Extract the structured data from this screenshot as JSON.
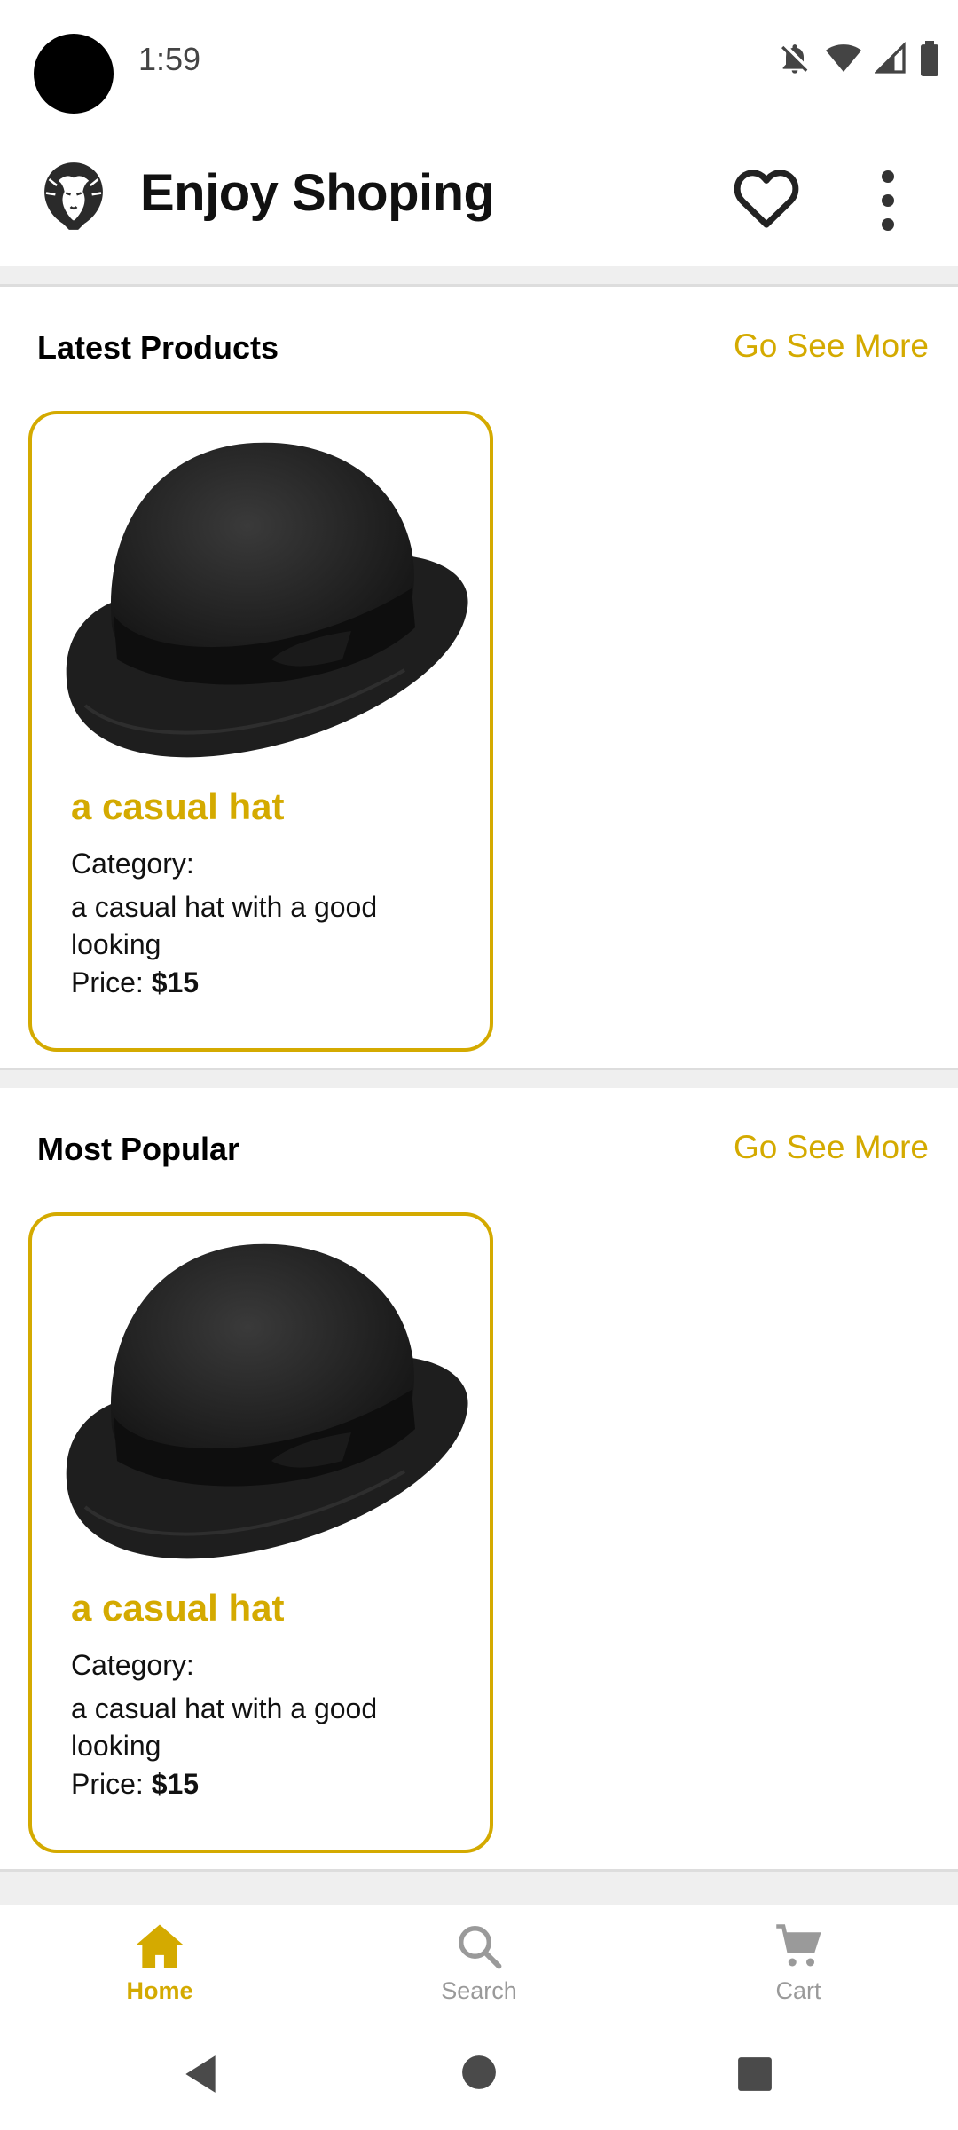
{
  "status_bar": {
    "time": "1:59"
  },
  "app_bar": {
    "title": "Enjoy Shoping"
  },
  "sections": [
    {
      "title": "Latest Products",
      "see_more": "Go See More",
      "product": {
        "name": "a casual hat",
        "category_label": "Category:",
        "description": "a casual hat with a good looking",
        "price_label": "Price:",
        "price": "$15"
      }
    },
    {
      "title": "Most Popular",
      "see_more": "Go See More",
      "product": {
        "name": "a casual hat",
        "category_label": "Category:",
        "description": "a casual hat with a good looking",
        "price_label": "Price:",
        "price": "$15"
      }
    }
  ],
  "bottom_nav": [
    {
      "label": "Home",
      "icon": "home-icon",
      "active": true
    },
    {
      "label": "Search",
      "icon": "search-icon",
      "active": false
    },
    {
      "label": "Cart",
      "icon": "cart-icon",
      "active": false
    }
  ],
  "colors": {
    "accent": "#d4aa00",
    "inactive": "#9a9a9a"
  }
}
